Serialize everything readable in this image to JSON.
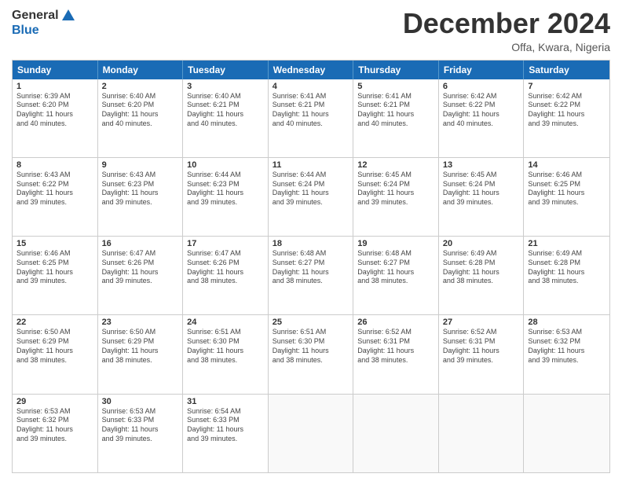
{
  "logo": {
    "general": "General",
    "blue": "Blue"
  },
  "title": "December 2024",
  "location": "Offa, Kwara, Nigeria",
  "header_days": [
    "Sunday",
    "Monday",
    "Tuesday",
    "Wednesday",
    "Thursday",
    "Friday",
    "Saturday"
  ],
  "weeks": [
    [
      {
        "day": "1",
        "info": "Sunrise: 6:39 AM\nSunset: 6:20 PM\nDaylight: 11 hours\nand 40 minutes."
      },
      {
        "day": "2",
        "info": "Sunrise: 6:40 AM\nSunset: 6:20 PM\nDaylight: 11 hours\nand 40 minutes."
      },
      {
        "day": "3",
        "info": "Sunrise: 6:40 AM\nSunset: 6:21 PM\nDaylight: 11 hours\nand 40 minutes."
      },
      {
        "day": "4",
        "info": "Sunrise: 6:41 AM\nSunset: 6:21 PM\nDaylight: 11 hours\nand 40 minutes."
      },
      {
        "day": "5",
        "info": "Sunrise: 6:41 AM\nSunset: 6:21 PM\nDaylight: 11 hours\nand 40 minutes."
      },
      {
        "day": "6",
        "info": "Sunrise: 6:42 AM\nSunset: 6:22 PM\nDaylight: 11 hours\nand 40 minutes."
      },
      {
        "day": "7",
        "info": "Sunrise: 6:42 AM\nSunset: 6:22 PM\nDaylight: 11 hours\nand 39 minutes."
      }
    ],
    [
      {
        "day": "8",
        "info": "Sunrise: 6:43 AM\nSunset: 6:22 PM\nDaylight: 11 hours\nand 39 minutes."
      },
      {
        "day": "9",
        "info": "Sunrise: 6:43 AM\nSunset: 6:23 PM\nDaylight: 11 hours\nand 39 minutes."
      },
      {
        "day": "10",
        "info": "Sunrise: 6:44 AM\nSunset: 6:23 PM\nDaylight: 11 hours\nand 39 minutes."
      },
      {
        "day": "11",
        "info": "Sunrise: 6:44 AM\nSunset: 6:24 PM\nDaylight: 11 hours\nand 39 minutes."
      },
      {
        "day": "12",
        "info": "Sunrise: 6:45 AM\nSunset: 6:24 PM\nDaylight: 11 hours\nand 39 minutes."
      },
      {
        "day": "13",
        "info": "Sunrise: 6:45 AM\nSunset: 6:24 PM\nDaylight: 11 hours\nand 39 minutes."
      },
      {
        "day": "14",
        "info": "Sunrise: 6:46 AM\nSunset: 6:25 PM\nDaylight: 11 hours\nand 39 minutes."
      }
    ],
    [
      {
        "day": "15",
        "info": "Sunrise: 6:46 AM\nSunset: 6:25 PM\nDaylight: 11 hours\nand 39 minutes."
      },
      {
        "day": "16",
        "info": "Sunrise: 6:47 AM\nSunset: 6:26 PM\nDaylight: 11 hours\nand 39 minutes."
      },
      {
        "day": "17",
        "info": "Sunrise: 6:47 AM\nSunset: 6:26 PM\nDaylight: 11 hours\nand 38 minutes."
      },
      {
        "day": "18",
        "info": "Sunrise: 6:48 AM\nSunset: 6:27 PM\nDaylight: 11 hours\nand 38 minutes."
      },
      {
        "day": "19",
        "info": "Sunrise: 6:48 AM\nSunset: 6:27 PM\nDaylight: 11 hours\nand 38 minutes."
      },
      {
        "day": "20",
        "info": "Sunrise: 6:49 AM\nSunset: 6:28 PM\nDaylight: 11 hours\nand 38 minutes."
      },
      {
        "day": "21",
        "info": "Sunrise: 6:49 AM\nSunset: 6:28 PM\nDaylight: 11 hours\nand 38 minutes."
      }
    ],
    [
      {
        "day": "22",
        "info": "Sunrise: 6:50 AM\nSunset: 6:29 PM\nDaylight: 11 hours\nand 38 minutes."
      },
      {
        "day": "23",
        "info": "Sunrise: 6:50 AM\nSunset: 6:29 PM\nDaylight: 11 hours\nand 38 minutes."
      },
      {
        "day": "24",
        "info": "Sunrise: 6:51 AM\nSunset: 6:30 PM\nDaylight: 11 hours\nand 38 minutes."
      },
      {
        "day": "25",
        "info": "Sunrise: 6:51 AM\nSunset: 6:30 PM\nDaylight: 11 hours\nand 38 minutes."
      },
      {
        "day": "26",
        "info": "Sunrise: 6:52 AM\nSunset: 6:31 PM\nDaylight: 11 hours\nand 38 minutes."
      },
      {
        "day": "27",
        "info": "Sunrise: 6:52 AM\nSunset: 6:31 PM\nDaylight: 11 hours\nand 39 minutes."
      },
      {
        "day": "28",
        "info": "Sunrise: 6:53 AM\nSunset: 6:32 PM\nDaylight: 11 hours\nand 39 minutes."
      }
    ],
    [
      {
        "day": "29",
        "info": "Sunrise: 6:53 AM\nSunset: 6:32 PM\nDaylight: 11 hours\nand 39 minutes."
      },
      {
        "day": "30",
        "info": "Sunrise: 6:53 AM\nSunset: 6:33 PM\nDaylight: 11 hours\nand 39 minutes."
      },
      {
        "day": "31",
        "info": "Sunrise: 6:54 AM\nSunset: 6:33 PM\nDaylight: 11 hours\nand 39 minutes."
      },
      {
        "day": "",
        "info": ""
      },
      {
        "day": "",
        "info": ""
      },
      {
        "day": "",
        "info": ""
      },
      {
        "day": "",
        "info": ""
      }
    ]
  ]
}
